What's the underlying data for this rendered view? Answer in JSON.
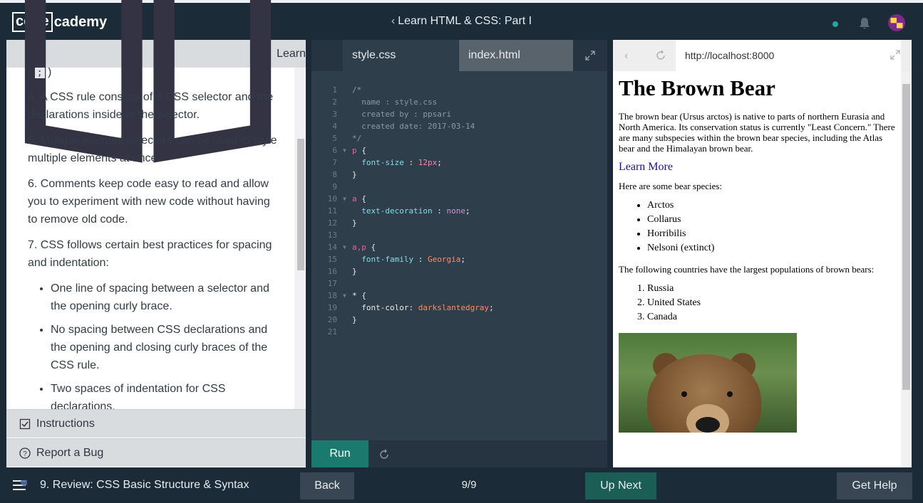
{
  "header": {
    "logo_code": "code",
    "logo_rest": "cademy",
    "course_title": "Learn HTML & CSS: Part I"
  },
  "left_panel": {
    "learn_label": "Learn",
    "lesson": {
      "partial_top": ";",
      "items": [
        "4. A CSS rule consists of a CSS selector and the declarations inside of the selector.",
        "5. Multiple element selectors can be used to style multiple elements at once.",
        "6. Comments keep code easy to read and allow you to experiment with new code without having to remove old code.",
        "7. CSS follows certain best practices for spacing and indentation:"
      ],
      "bullets": [
        "One line of spacing between a selector and the opening curly brace.",
        "No spacing between CSS declarations and the opening and closing curly braces of the CSS rule.",
        "Two spaces of indentation for CSS declarations."
      ]
    },
    "instructions_label": "Instructions",
    "report_bug_label": "Report a Bug"
  },
  "editor": {
    "active_tab": "style.css",
    "inactive_tab": "index.html",
    "run_label": "Run"
  },
  "browser": {
    "url": "http://localhost:8000",
    "h1": "The Brown Bear",
    "intro": "The brown bear (Ursus arctos) is native to parts of northern Eurasia and North America. Its conservation status is currently \"Least Concern.\" There are many subspecies within the brown bear species, including the Atlas bear and the Himalayan brown bear.",
    "link": "Learn More",
    "species_intro": "Here are some bear species:",
    "species": [
      "Arctos",
      "Collarus",
      "Horribilis",
      "Nelsoni (extinct)"
    ],
    "countries_intro": "The following countries have the largest populations of brown bears:",
    "countries": [
      "Russia",
      "United States",
      "Canada"
    ]
  },
  "footer": {
    "step_title": "9. Review: CSS Basic Structure & Syntax",
    "back_label": "Back",
    "progress": "9/9",
    "next_label": "Up Next",
    "help_label": "Get Help"
  },
  "colors": {
    "topbar": "#1c2b38",
    "editor_bg": "#2f3e4b",
    "run_button": "#1b7a6e",
    "next_button": "#1b5e56"
  }
}
